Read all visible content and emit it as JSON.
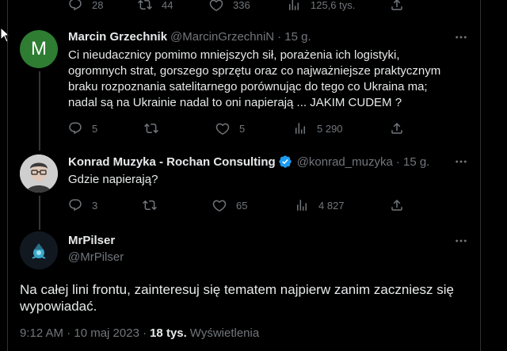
{
  "top_actions": {
    "replies": "28",
    "retweets": "44",
    "likes": "336",
    "views": "125,6 tys."
  },
  "tweets": [
    {
      "name": "Marcin Grzechnik",
      "handle": "@MarcinGrzechniN",
      "time": "· 15 g.",
      "avatar_letter": "M",
      "avatar_color": "#2e7d32",
      "lines": [
        "Ci nieudacznicy pomimo mniejszych sił, porażenia ich logistyki,",
        "ogromnych strat, gorszego sprzętu oraz co najważniejsze praktycznym",
        "braku rozpoznania satelitarnego porównując do tego co Ukraina ma;",
        "nadal są na Ukrainie nadal to oni napierają ... JAKIM CUDEM ?"
      ],
      "replies": "5",
      "retweets": "",
      "likes": "5",
      "views": "5 290"
    },
    {
      "name": "Konrad Muzyka - Rochan Consulting",
      "handle": "@konrad_muzyka",
      "time": "· 15 g.",
      "verified": true,
      "lines": [
        "Gdzie napierają?"
      ],
      "replies": "3",
      "retweets": "",
      "likes": "65",
      "views": "4 827"
    }
  ],
  "main_tweet": {
    "name": "MrPilser",
    "handle": "@MrPilser",
    "text_line1": "Na całej lini frontu, zainteresuj się tematem najpierw zanim zaczniesz się",
    "text_line2": "wypowiadać.",
    "timestamp": "9:12 AM · 10 maj 2023 ·",
    "views_count": "18 tys.",
    "views_label": "Wyświetlenia"
  },
  "colors": {
    "accent": "#1d9bf0",
    "muted": "#71767b",
    "text": "#e7e9ea",
    "border": "#2f3336"
  }
}
